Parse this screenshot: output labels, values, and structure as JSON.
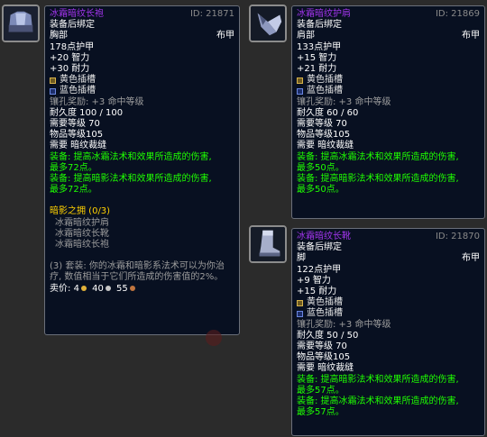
{
  "tooltips": [
    {
      "name": "冰霜暗纹长袍",
      "id": "ID: 21871",
      "bind": "装备后绑定",
      "slot": "胸部",
      "armor_type": "布甲",
      "armor": "178点护甲",
      "stat1": "+20 智力",
      "stat2": "+30 耐力",
      "socket_yellow": "黄色插槽",
      "socket_blue": "蓝色插槽",
      "socket_bonus": "镶孔奖励: +3 命中等级",
      "durability": "耐久度 100 / 100",
      "req_level": "需要等级 70",
      "item_level": "物品等级105",
      "req_skill": "需要 暗纹裁缝",
      "equip1a": "装备:  提高冰霜法术和效果所造成的伤害,",
      "equip1b": "最多72点。",
      "equip2a": "装备:  提高暗影法术和效果所造成的伤害,",
      "equip2b": "最多72点。",
      "set_name": "暗影之拥  (0/3)",
      "set_items": [
        "冰霜暗纹护肩",
        "冰霜暗纹长靴",
        "冰霜暗纹长袍"
      ],
      "set_bonus_a": "(3) 套装:  你的冰霜和暗影系法术可以为你治",
      "set_bonus_b": "疗, 数值相当于它们所造成的伤害值的2%。",
      "sell_label": "卖价:",
      "sell_gold": "4",
      "sell_silver": "40",
      "sell_copper": "55"
    },
    {
      "name": "冰霜暗纹护肩",
      "id": "ID: 21869",
      "bind": "装备后绑定",
      "slot": "肩部",
      "armor_type": "布甲",
      "armor": "133点护甲",
      "stat1": "+15 智力",
      "stat2": "+21 耐力",
      "socket_yellow": "黄色插槽",
      "socket_blue": "蓝色插槽",
      "socket_bonus": "镶孔奖励: +3 命中等级",
      "durability": "耐久度 60 / 60",
      "req_level": "需要等级 70",
      "item_level": "物品等级105",
      "req_skill": "需要 暗纹裁缝",
      "equip1a": "装备:  提高冰霜法术和效果所造成的伤害,",
      "equip1b": "最多50点。",
      "equip2a": "装备:  提高暗影法术和效果所造成的伤害,",
      "equip2b": "最多50点。"
    },
    {
      "name": "冰霜暗纹长靴",
      "id": "ID: 21870",
      "bind": "装备后绑定",
      "slot": "脚",
      "armor_type": "布甲",
      "armor": "122点护甲",
      "stat1": "+9 智力",
      "stat2": "+15 耐力",
      "socket_yellow": "黄色插槽",
      "socket_blue": "蓝色插槽",
      "socket_bonus": "镶孔奖励: +3 命中等级",
      "durability": "耐久度 50 / 50",
      "req_level": "需要等级 70",
      "item_level": "物品等级105",
      "req_skill": "需要 暗纹裁缝",
      "equip1a": "装备:  提高暗影法术和效果所造成的伤害,",
      "equip1b": "最多57点。",
      "equip2a": "装备:  提高冰霜法术和效果所造成的伤害,",
      "equip2b": "最多57点。"
    }
  ]
}
